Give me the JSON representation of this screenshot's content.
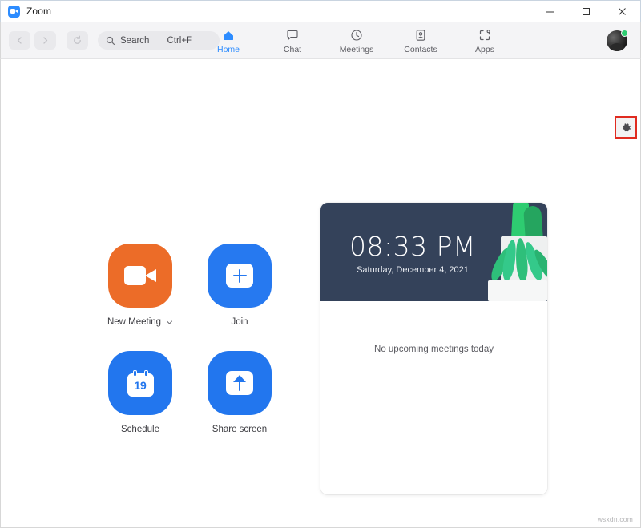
{
  "window": {
    "title": "Zoom",
    "app_icon": "zoom-camera-icon",
    "controls": {
      "minimize": "minimize-icon",
      "maximize": "maximize-icon",
      "close": "close-icon"
    }
  },
  "toolbar": {
    "back": "chevron-left-icon",
    "forward": "chevron-right-icon",
    "refresh": "refresh-icon",
    "search": {
      "placeholder": "Search",
      "shortcut": "Ctrl+F",
      "icon": "search-icon"
    },
    "tabs": [
      {
        "label": "Home",
        "icon": "home-icon",
        "active": true
      },
      {
        "label": "Chat",
        "icon": "chat-bubble-icon",
        "active": false
      },
      {
        "label": "Meetings",
        "icon": "clock-icon",
        "active": false
      },
      {
        "label": "Contacts",
        "icon": "contact-card-icon",
        "active": false
      },
      {
        "label": "Apps",
        "icon": "apps-icon",
        "active": false
      }
    ],
    "avatar": {
      "name": "user-avatar",
      "status": "available",
      "status_color": "#2ecc71"
    }
  },
  "annotation": {
    "gear": {
      "icon": "gear-icon",
      "highlight_color": "#e02b20"
    }
  },
  "actions": [
    {
      "label": "New Meeting",
      "icon": "video-camera-icon",
      "color": "#EC6C28",
      "has_dropdown": true,
      "dropdown_icon": "chevron-down-icon"
    },
    {
      "label": "Join",
      "icon": "plus-icon",
      "color": "#2679F0",
      "has_dropdown": false
    },
    {
      "label": "Schedule",
      "icon": "calendar-icon",
      "calendar_day": "19",
      "color": "#2276EE",
      "has_dropdown": false
    },
    {
      "label": "Share screen",
      "icon": "arrow-up-icon",
      "color": "#2276EE",
      "has_dropdown": false
    }
  ],
  "meeting_card": {
    "time": "08:33 PM",
    "date": "Saturday, December 4, 2021",
    "header_color": "#34425a",
    "empty_state": "No upcoming meetings today",
    "illustration": "potted-plant-illustration"
  },
  "watermark": "wsxdn.com"
}
